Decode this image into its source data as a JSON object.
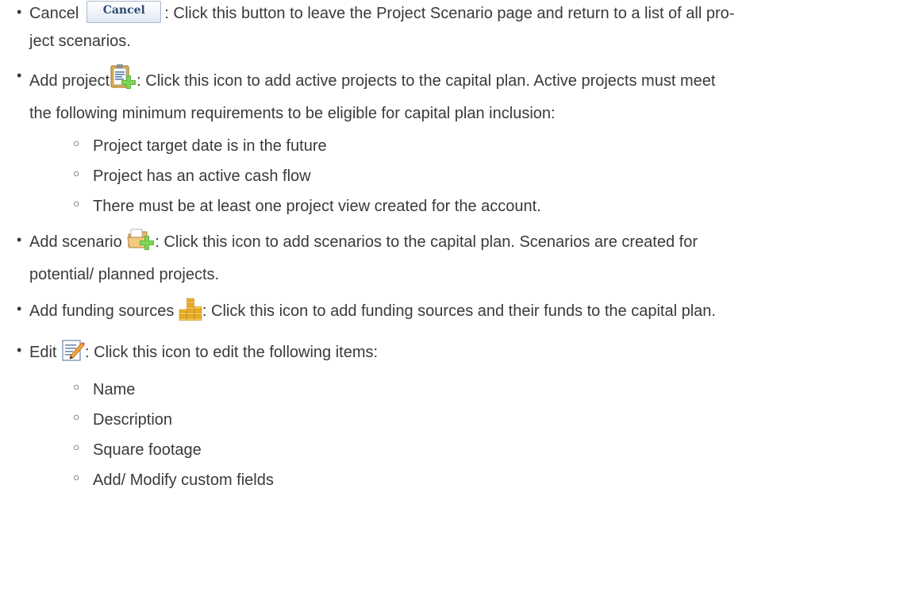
{
  "items": [
    {
      "label": "Cancel",
      "button_label": "Cancel",
      "icon": "cancel-button-icon",
      "description": ": Click this button to leave the Project Scenario page and return to a list of all pro-",
      "description_cont": "ject scenarios."
    },
    {
      "label": "Add project",
      "icon": "add-project-icon",
      "description": ": Click this icon to add active projects to the capital plan. Active projects must meet",
      "description_cont": "the following minimum requirements to be eligible for capital plan inclusion:",
      "subitems": [
        "Project target date is in the future",
        "Project has an active cash flow",
        "There must be at least one project view created for the account."
      ]
    },
    {
      "label": "Add scenario",
      "icon": "add-scenario-icon",
      "description": ": Click this icon to add scenarios to the capital plan. Scenarios are created for",
      "description_cont": "potential/ planned projects."
    },
    {
      "label": "Add funding sources",
      "icon": "funding-sources-icon",
      "description": ": Click this icon to add funding sources and their funds to the capital plan."
    },
    {
      "label": "Edit",
      "icon": "edit-icon",
      "description": ": Click this icon to edit the following items:",
      "subitems": [
        "Name",
        "Description",
        "Square footage",
        "Add/ Modify custom fields"
      ]
    }
  ],
  "colors": {
    "text": "#3a3a3a",
    "button_text": "#2d4a72",
    "green_plus": "#5bb83a",
    "coin_gold": "#f0b429"
  }
}
